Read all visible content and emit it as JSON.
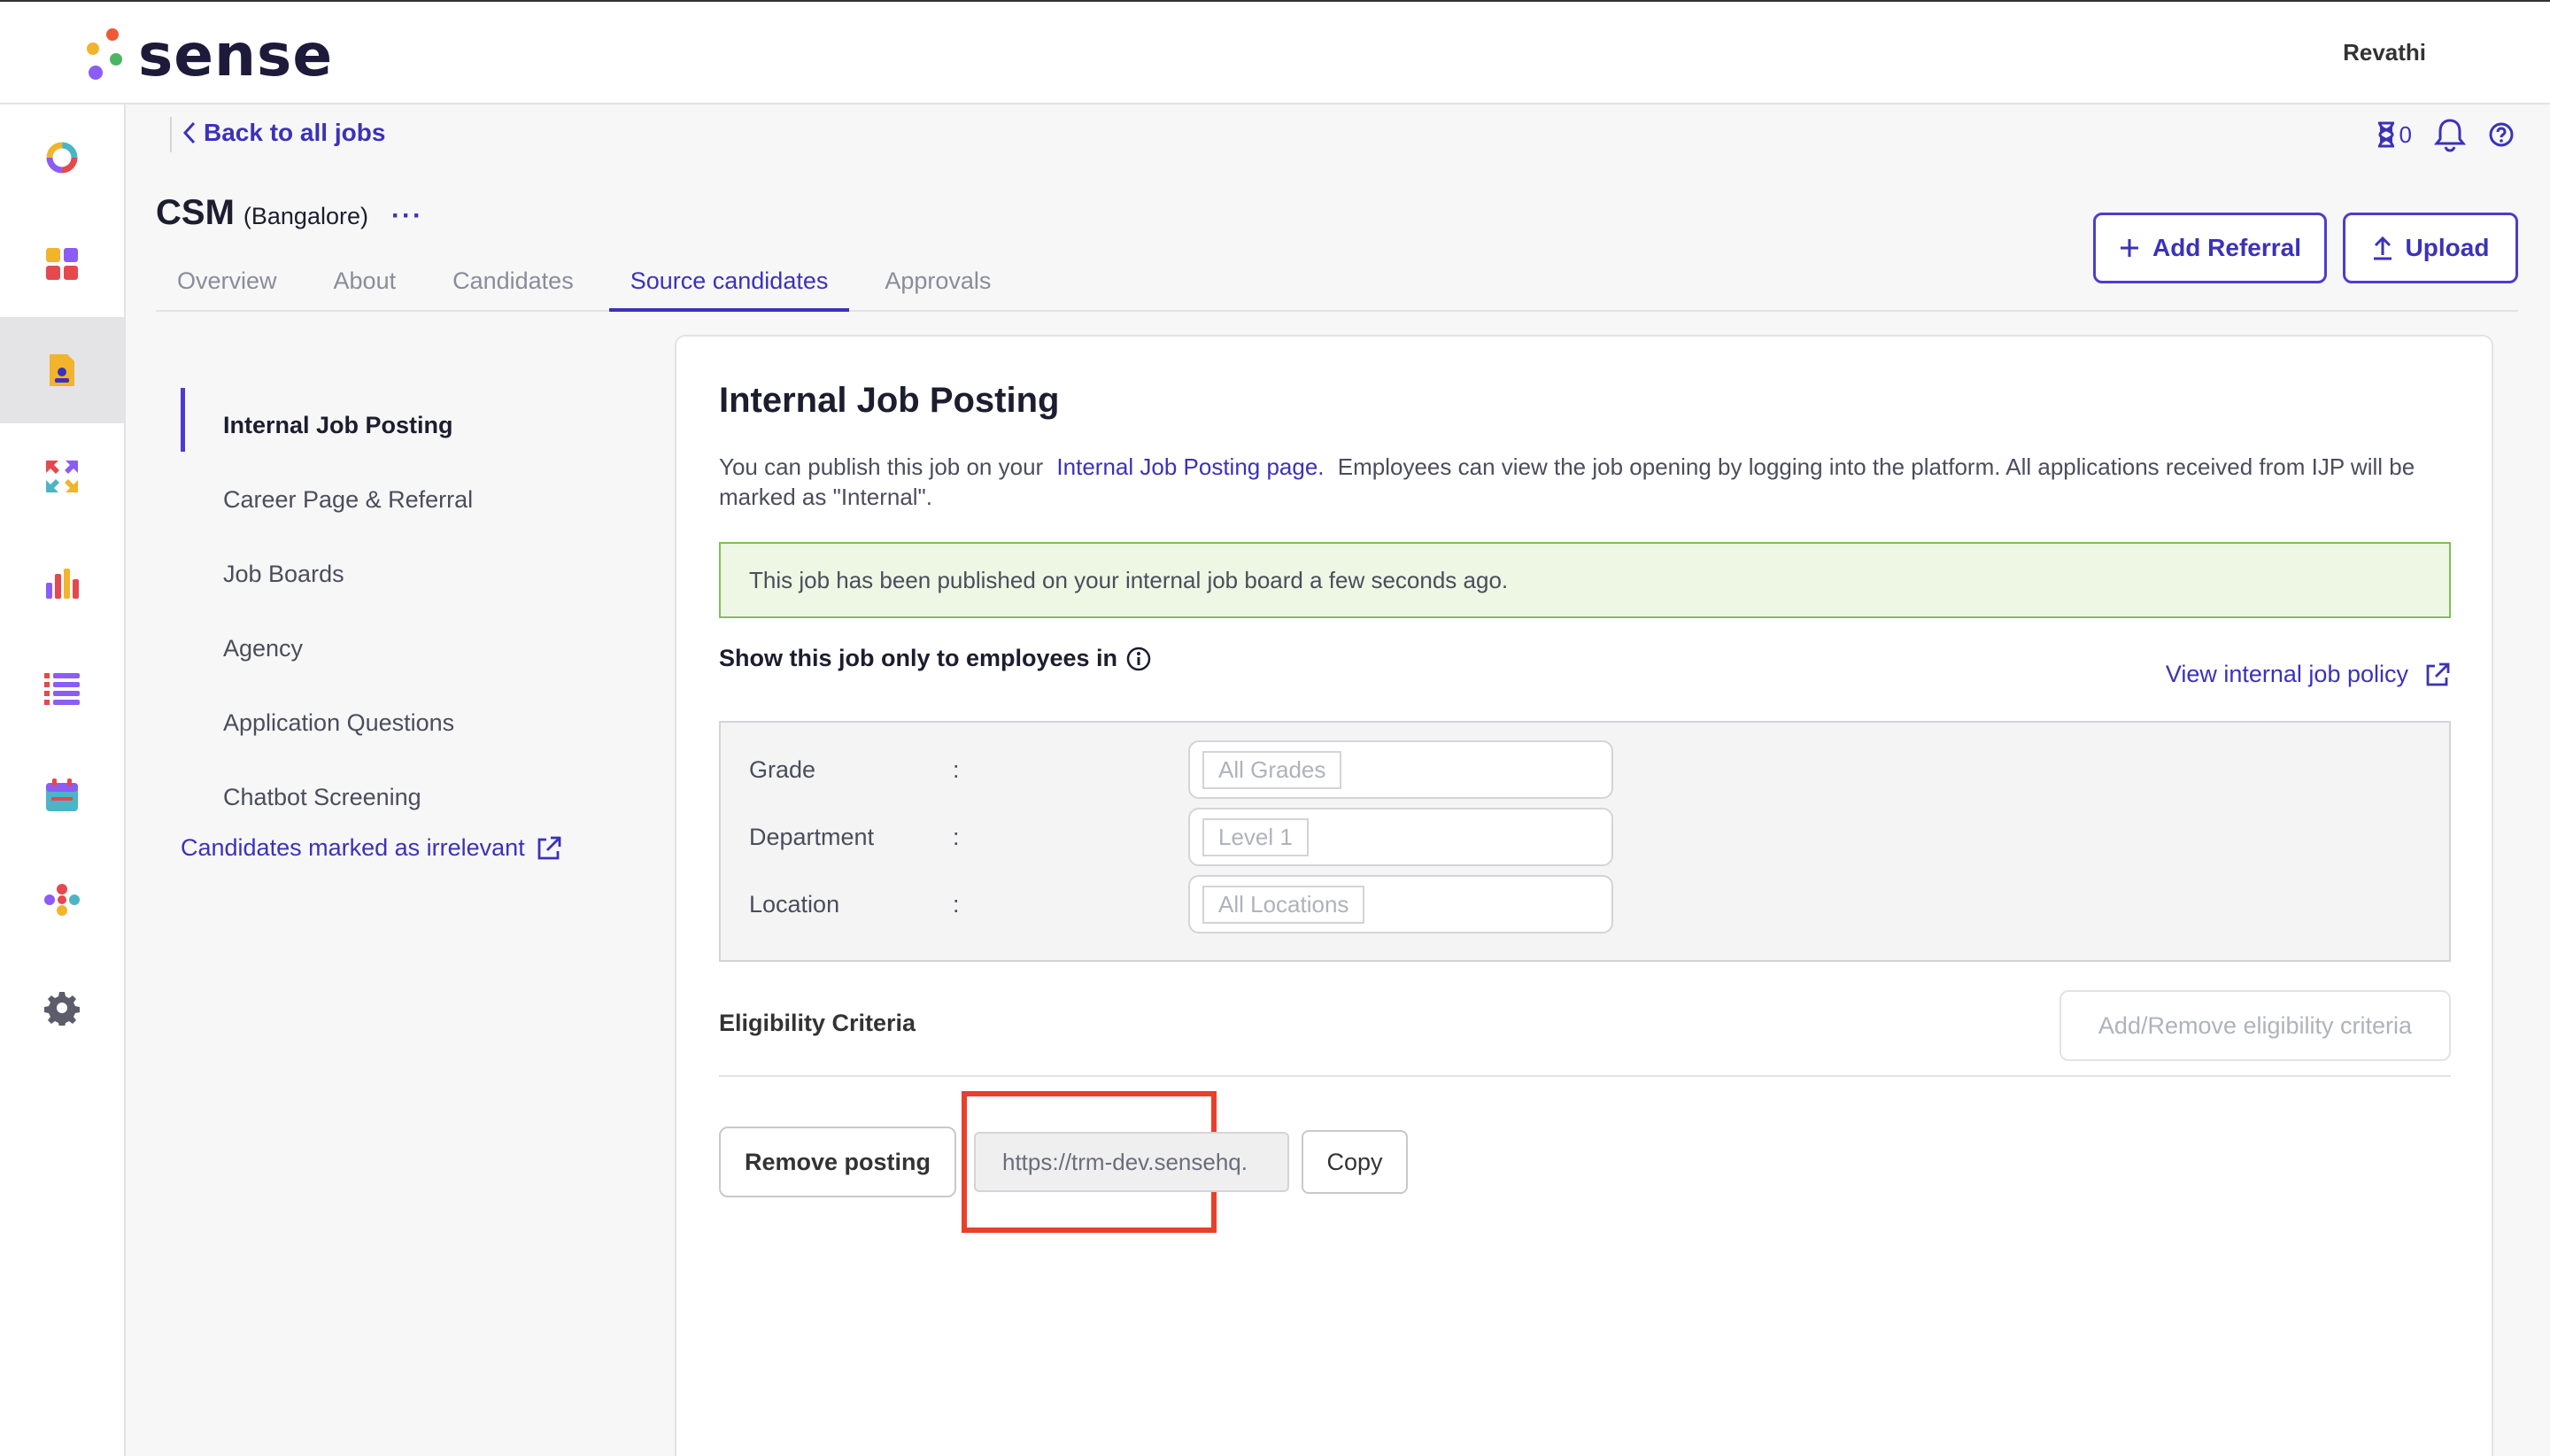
{
  "app": {
    "brand": "sense",
    "user": "Revathi"
  },
  "colors": {
    "accent": "#3b32b8",
    "success_bg": "#eef7e4",
    "success_border": "#7fbf5a",
    "highlight": "#e8402a"
  },
  "rail": {
    "items": [
      {
        "icon": "donut-icon"
      },
      {
        "icon": "dashboard-icon"
      },
      {
        "icon": "jobs-icon",
        "active": true
      },
      {
        "icon": "referral-arrows-icon"
      },
      {
        "icon": "analytics-icon"
      },
      {
        "icon": "list-icon"
      },
      {
        "icon": "calendar-icon"
      },
      {
        "icon": "people-icon"
      },
      {
        "icon": "gear-icon"
      }
    ]
  },
  "header": {
    "back_label": "Back to all jobs",
    "timer_count": "0",
    "job_name": "CSM",
    "job_location": "(Bangalore)",
    "more": "···"
  },
  "tabs": [
    "Overview",
    "About",
    "Candidates",
    "Source candidates",
    "Approvals"
  ],
  "actions": {
    "add_referral": "Add Referral",
    "upload": "Upload"
  },
  "source_nav": {
    "items": [
      "Internal Job Posting",
      "Career Page & Referral",
      "Job Boards",
      "Agency",
      "Application Questions",
      "Chatbot Screening"
    ],
    "irrelevant_link": "Candidates marked as irrelevant"
  },
  "card": {
    "title": "Internal Job Posting",
    "desc_prefix": "You can publish this job on your",
    "desc_link": "Internal Job Posting page.",
    "desc_suffix": "Employees can view the job opening by logging into the platform. All applications received from IJP will be marked as \"Internal\".",
    "success_message": "This job has been published on your internal job board a few seconds ago.",
    "show_only_label": "Show this job only to employees in",
    "policy_link": "View internal job policy",
    "filters": [
      {
        "label": "Grade",
        "colon": ":",
        "value": "All Grades"
      },
      {
        "label": "Department",
        "colon": ":",
        "value": "Level 1"
      },
      {
        "label": "Location",
        "colon": ":",
        "value": "All Locations"
      }
    ],
    "eligibility_label": "Eligibility Criteria",
    "eligibility_button": "Add/Remove eligibility criteria",
    "remove_button": "Remove posting",
    "posting_url": "https://trm-dev.sensehq.",
    "copy_button": "Copy"
  }
}
